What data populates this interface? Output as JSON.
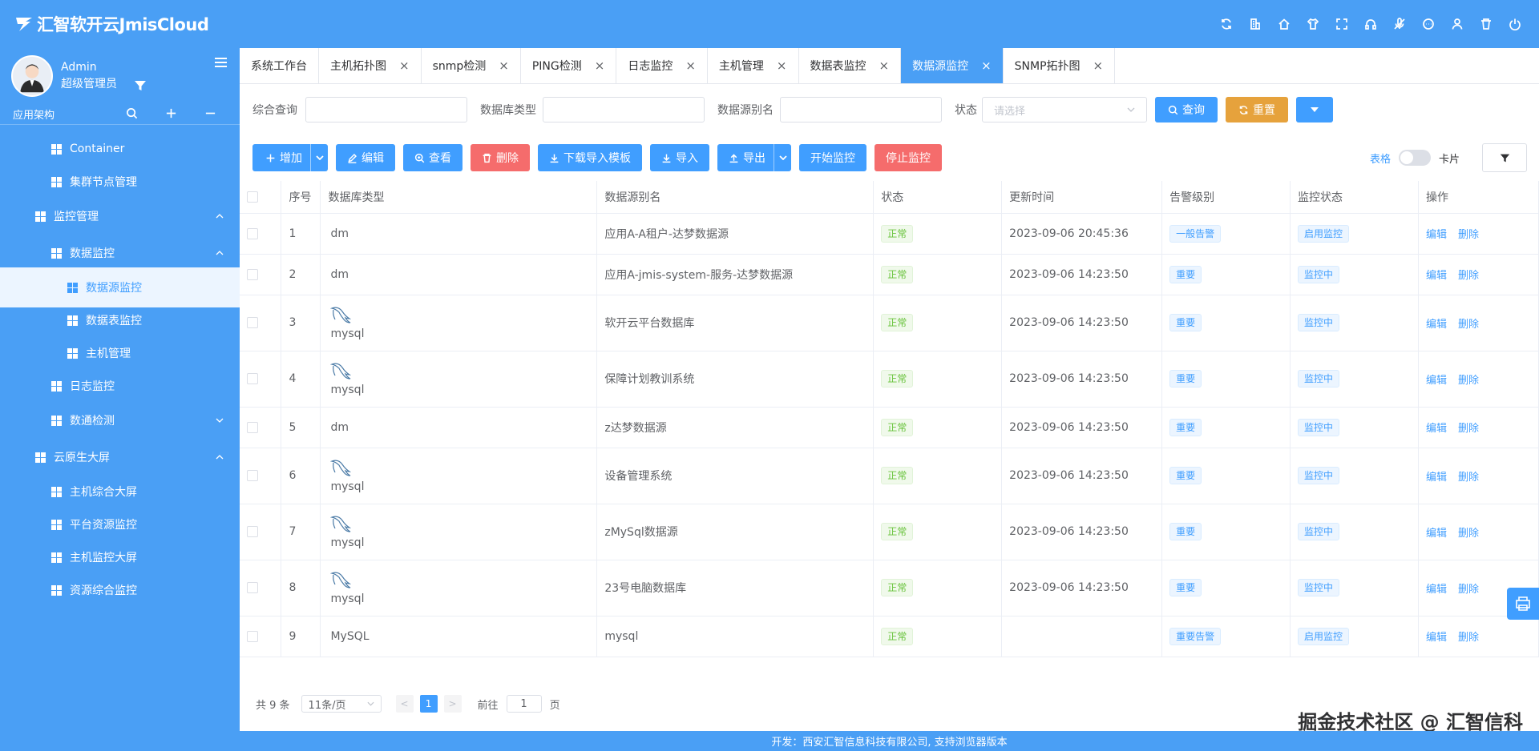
{
  "header": {
    "brand": "汇智软开云JmisCloud",
    "icons": [
      "refresh-icon",
      "building-icon",
      "home-icon",
      "shirt-icon",
      "fullscreen-icon",
      "headset-icon",
      "mic-off-icon",
      "chat-icon",
      "user-icon",
      "trash-icon",
      "power-icon"
    ]
  },
  "sidebar": {
    "user_name": "Admin",
    "user_role": "超级管理员",
    "section_title": "应用架构",
    "items": [
      {
        "label": "Container",
        "level": 2,
        "expanded": null,
        "active": false
      },
      {
        "label": "集群节点管理",
        "level": 2,
        "expanded": null,
        "active": false
      },
      {
        "label": "监控管理",
        "level": 1,
        "expanded": true,
        "active": false
      },
      {
        "label": "数据监控",
        "level": 2,
        "expanded": true,
        "active": false
      },
      {
        "label": "数据源监控",
        "level": 3,
        "expanded": null,
        "active": true
      },
      {
        "label": "数据表监控",
        "level": 3,
        "expanded": null,
        "active": false
      },
      {
        "label": "主机管理",
        "level": 3,
        "expanded": null,
        "active": false
      },
      {
        "label": "日志监控",
        "level": 2,
        "expanded": null,
        "active": false
      },
      {
        "label": "数通检测",
        "level": 2,
        "expanded": false,
        "active": false
      },
      {
        "label": "云原生大屏",
        "level": 1,
        "expanded": true,
        "active": false
      },
      {
        "label": "主机综合大屏",
        "level": 2,
        "expanded": null,
        "active": false
      },
      {
        "label": "平台资源监控",
        "level": 2,
        "expanded": null,
        "active": false
      },
      {
        "label": "主机监控大屏",
        "level": 2,
        "expanded": null,
        "active": false
      },
      {
        "label": "资源综合监控",
        "level": 2,
        "expanded": null,
        "active": false
      }
    ]
  },
  "tabs": [
    {
      "label": "系统工作台",
      "closable": false,
      "active": false
    },
    {
      "label": "主机拓扑图",
      "closable": true,
      "active": false
    },
    {
      "label": "snmp检测",
      "closable": true,
      "active": false
    },
    {
      "label": "PING检测",
      "closable": true,
      "active": false
    },
    {
      "label": "日志监控",
      "closable": true,
      "active": false
    },
    {
      "label": "主机管理",
      "closable": true,
      "active": false
    },
    {
      "label": "数据表监控",
      "closable": true,
      "active": false
    },
    {
      "label": "数据源监控",
      "closable": true,
      "active": true
    },
    {
      "label": "SNMP拓扑图",
      "closable": true,
      "active": false
    }
  ],
  "tab_close": "×",
  "search": {
    "f1_label": "综合查询",
    "f2_label": "数据库类型",
    "f3_label": "数据源别名",
    "f4_label": "状态",
    "f4_placeholder": "请选择",
    "query": "查询",
    "reset": "重置"
  },
  "toolbar": {
    "add": "增加",
    "edit": "编辑",
    "view": "查看",
    "delete": "删除",
    "download_tpl": "下载导入模板",
    "import": "导入",
    "export": "导出",
    "start": "开始监控",
    "stop": "停止监控",
    "view_table": "表格",
    "view_card": "卡片"
  },
  "table": {
    "columns": [
      "序号",
      "数据库类型",
      "数据源别名",
      "状态",
      "更新时间",
      "告警级别",
      "监控状态",
      "操作"
    ],
    "edit": "编辑",
    "del": "删除",
    "rows": [
      {
        "no": "1",
        "db": "dm",
        "icon": false,
        "alias": "应用A-A租户-达梦数据源",
        "status": "正常",
        "time": "2023-09-06 20:45:36",
        "level": "一般告警",
        "mon": "启用监控"
      },
      {
        "no": "2",
        "db": "dm",
        "icon": false,
        "alias": "应用A-jmis-system-服务-达梦数据源",
        "status": "正常",
        "time": "2023-09-06 14:23:50",
        "level": "重要",
        "mon": "监控中"
      },
      {
        "no": "3",
        "db": "mysql",
        "icon": true,
        "alias": "软开云平台数据库",
        "status": "正常",
        "time": "2023-09-06 14:23:50",
        "level": "重要",
        "mon": "监控中"
      },
      {
        "no": "4",
        "db": "mysql",
        "icon": true,
        "alias": "保障计划教训系统",
        "status": "正常",
        "time": "2023-09-06 14:23:50",
        "level": "重要",
        "mon": "监控中"
      },
      {
        "no": "5",
        "db": "dm",
        "icon": false,
        "alias": "z达梦数据源",
        "status": "正常",
        "time": "2023-09-06 14:23:50",
        "level": "重要",
        "mon": "监控中"
      },
      {
        "no": "6",
        "db": "mysql",
        "icon": true,
        "alias": "设备管理系统",
        "status": "正常",
        "time": "2023-09-06 14:23:50",
        "level": "重要",
        "mon": "监控中"
      },
      {
        "no": "7",
        "db": "mysql",
        "icon": true,
        "alias": "zMySql数据源",
        "status": "正常",
        "time": "2023-09-06 14:23:50",
        "level": "重要",
        "mon": "监控中"
      },
      {
        "no": "8",
        "db": "mysql",
        "icon": true,
        "alias": "23号电脑数据库",
        "status": "正常",
        "time": "2023-09-06 14:23:50",
        "level": "重要",
        "mon": "监控中"
      },
      {
        "no": "9",
        "db": "MySQL",
        "icon": false,
        "alias": "mysql",
        "status": "正常",
        "time": "",
        "level": "重要告警",
        "mon": "启用监控"
      }
    ]
  },
  "pager": {
    "total": "共 9 条",
    "size": "11条/页",
    "prev": "<",
    "current": "1",
    "next": ">",
    "goto": "前往",
    "goto_value": "1",
    "page_unit": "页"
  },
  "footer": "开发：西安汇智信息科技有限公司, 支持浏览器版本",
  "watermark": "掘金技术社区 @ 汇智信科"
}
